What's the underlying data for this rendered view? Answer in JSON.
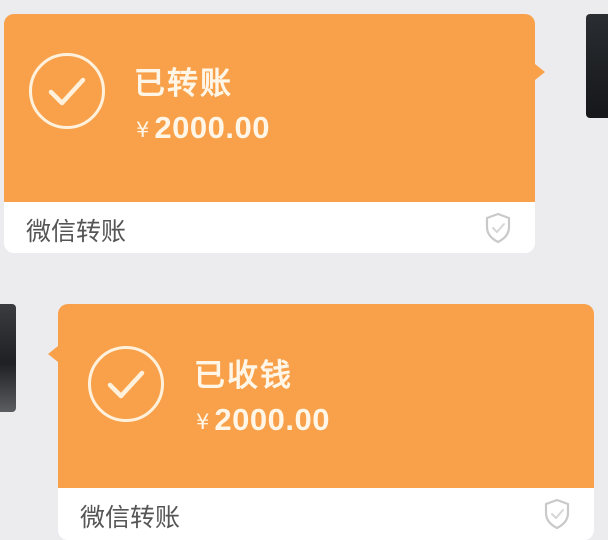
{
  "messages": [
    {
      "status": "已转账",
      "currency_symbol": "¥",
      "amount": "2000.00",
      "footer": "微信转账",
      "check_icon": "check-circle-icon",
      "shield_icon": "shield-icon"
    },
    {
      "status": "已收钱",
      "currency_symbol": "¥",
      "amount": "2000.00",
      "footer": "微信转账",
      "check_icon": "check-circle-icon",
      "shield_icon": "shield-icon"
    }
  ],
  "colors": {
    "background": "#ececef",
    "bubble_orange": "#f8a14a",
    "footer_bg": "#ffffff",
    "accent_text": "#fff6e8",
    "footer_text": "#555555"
  }
}
